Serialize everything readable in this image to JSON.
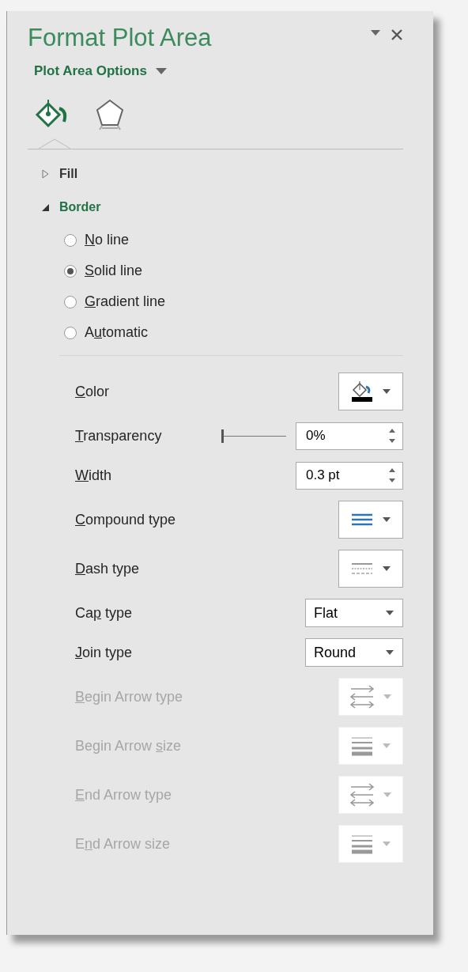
{
  "panel": {
    "title": "Format Plot Area",
    "options_label": "Plot Area Options",
    "icon_tabs": [
      {
        "kind": "fill",
        "selected": true
      },
      {
        "kind": "effects",
        "selected": false
      }
    ]
  },
  "sections": [
    {
      "title": "Fill",
      "expanded": false
    },
    {
      "title": "Border",
      "expanded": true
    }
  ],
  "line_options": [
    {
      "label": [
        {
          "text": "N",
          "key": true
        },
        {
          "text": "o line",
          "key": false
        }
      ],
      "selected": false
    },
    {
      "label": [
        {
          "text": "S",
          "key": true
        },
        {
          "text": "olid line",
          "key": false
        }
      ],
      "selected": true
    },
    {
      "label": [
        {
          "text": "G",
          "key": true
        },
        {
          "text": "radient line",
          "key": false
        }
      ],
      "selected": false
    },
    {
      "label": [
        {
          "text": "A",
          "key": false
        },
        {
          "text": "u",
          "key": true
        },
        {
          "text": "tomatic",
          "key": false
        }
      ],
      "selected": false
    }
  ],
  "properties": [
    {
      "kind": "color",
      "disabled": false,
      "label": [
        {
          "text": "C",
          "key": true
        },
        {
          "text": "olor",
          "key": false
        }
      ]
    },
    {
      "kind": "slider-spin",
      "disabled": false,
      "label": [
        {
          "text": "T",
          "key": true
        },
        {
          "text": "ransparency",
          "key": false
        }
      ],
      "level": 0,
      "value": "0%"
    },
    {
      "kind": "spin",
      "disabled": false,
      "label": [
        {
          "text": "W",
          "key": true
        },
        {
          "text": "idth",
          "key": false
        }
      ],
      "value": "0.3 pt"
    },
    {
      "kind": "compound",
      "disabled": false,
      "label": [
        {
          "text": "C",
          "key": true
        },
        {
          "text": "ompound type",
          "key": false
        }
      ]
    },
    {
      "kind": "dash",
      "disabled": false,
      "label": [
        {
          "text": "D",
          "key": true
        },
        {
          "text": "ash type",
          "key": false
        }
      ]
    },
    {
      "kind": "dropdown",
      "disabled": false,
      "label": [
        {
          "text": "Ca",
          "key": false
        },
        {
          "text": "p",
          "key": true
        },
        {
          "text": " type",
          "key": false
        }
      ],
      "value": "Flat"
    },
    {
      "kind": "dropdown",
      "disabled": false,
      "label": [
        {
          "text": "J",
          "key": true
        },
        {
          "text": "oin type",
          "key": false
        }
      ],
      "value": "Round"
    },
    {
      "kind": "arrow-type",
      "disabled": true,
      "label": [
        {
          "text": "B",
          "key": true
        },
        {
          "text": "egin Arrow type",
          "key": false
        }
      ]
    },
    {
      "kind": "arrow-size",
      "disabled": true,
      "label": [
        {
          "text": "Begin Arrow ",
          "key": false
        },
        {
          "text": "s",
          "key": true
        },
        {
          "text": "ize",
          "key": false
        }
      ]
    },
    {
      "kind": "arrow-type",
      "disabled": true,
      "label": [
        {
          "text": "E",
          "key": true
        },
        {
          "text": "nd Arrow type",
          "key": false
        }
      ]
    },
    {
      "kind": "arrow-size",
      "disabled": true,
      "label": [
        {
          "text": "E",
          "key": false
        },
        {
          "text": "n",
          "key": true
        },
        {
          "text": "d Arrow size",
          "key": false
        }
      ]
    }
  ]
}
